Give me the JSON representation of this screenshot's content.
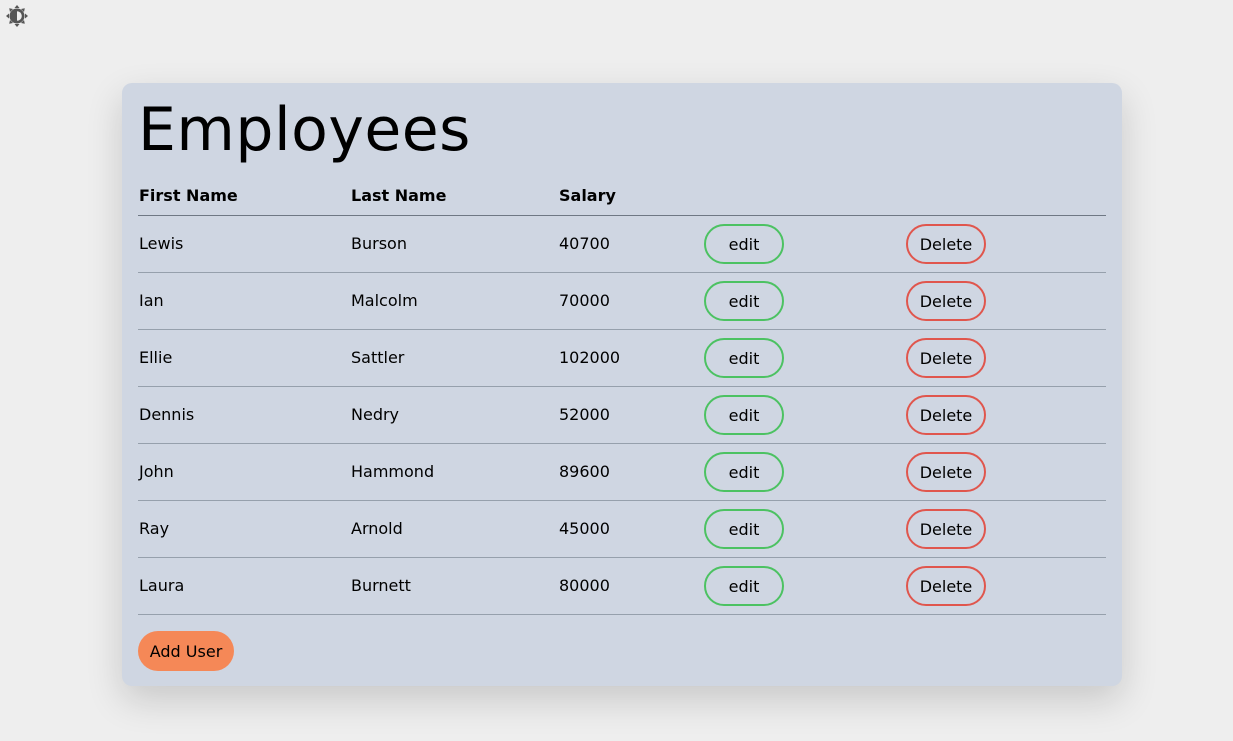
{
  "theme_toggle": {
    "icon": "half-moon-gear-icon"
  },
  "page": {
    "title": "Employees"
  },
  "table": {
    "headers": {
      "first_name": "First Name",
      "last_name": "Last Name",
      "salary": "Salary"
    },
    "rows": [
      {
        "first_name": "Lewis",
        "last_name": "Burson",
        "salary": "40700",
        "edit_label": "edit",
        "delete_label": "Delete"
      },
      {
        "first_name": "Ian",
        "last_name": "Malcolm",
        "salary": "70000",
        "edit_label": "edit",
        "delete_label": "Delete"
      },
      {
        "first_name": "Ellie",
        "last_name": "Sattler",
        "salary": "102000",
        "edit_label": "edit",
        "delete_label": "Delete"
      },
      {
        "first_name": "Dennis",
        "last_name": "Nedry",
        "salary": "52000",
        "edit_label": "edit",
        "delete_label": "Delete"
      },
      {
        "first_name": "John",
        "last_name": "Hammond",
        "salary": "89600",
        "edit_label": "edit",
        "delete_label": "Delete"
      },
      {
        "first_name": "Ray",
        "last_name": "Arnold",
        "salary": "45000",
        "edit_label": "edit",
        "delete_label": "Delete"
      },
      {
        "first_name": "Laura",
        "last_name": "Burnett",
        "salary": "80000",
        "edit_label": "edit",
        "delete_label": "Delete"
      }
    ]
  },
  "actions": {
    "add_user_label": "Add User"
  },
  "colors": {
    "background": "#eeeeee",
    "card": "#cfd6e2",
    "edit_border": "#4cc262",
    "delete_border": "#e0564d",
    "add_user_bg": "#f58857"
  }
}
